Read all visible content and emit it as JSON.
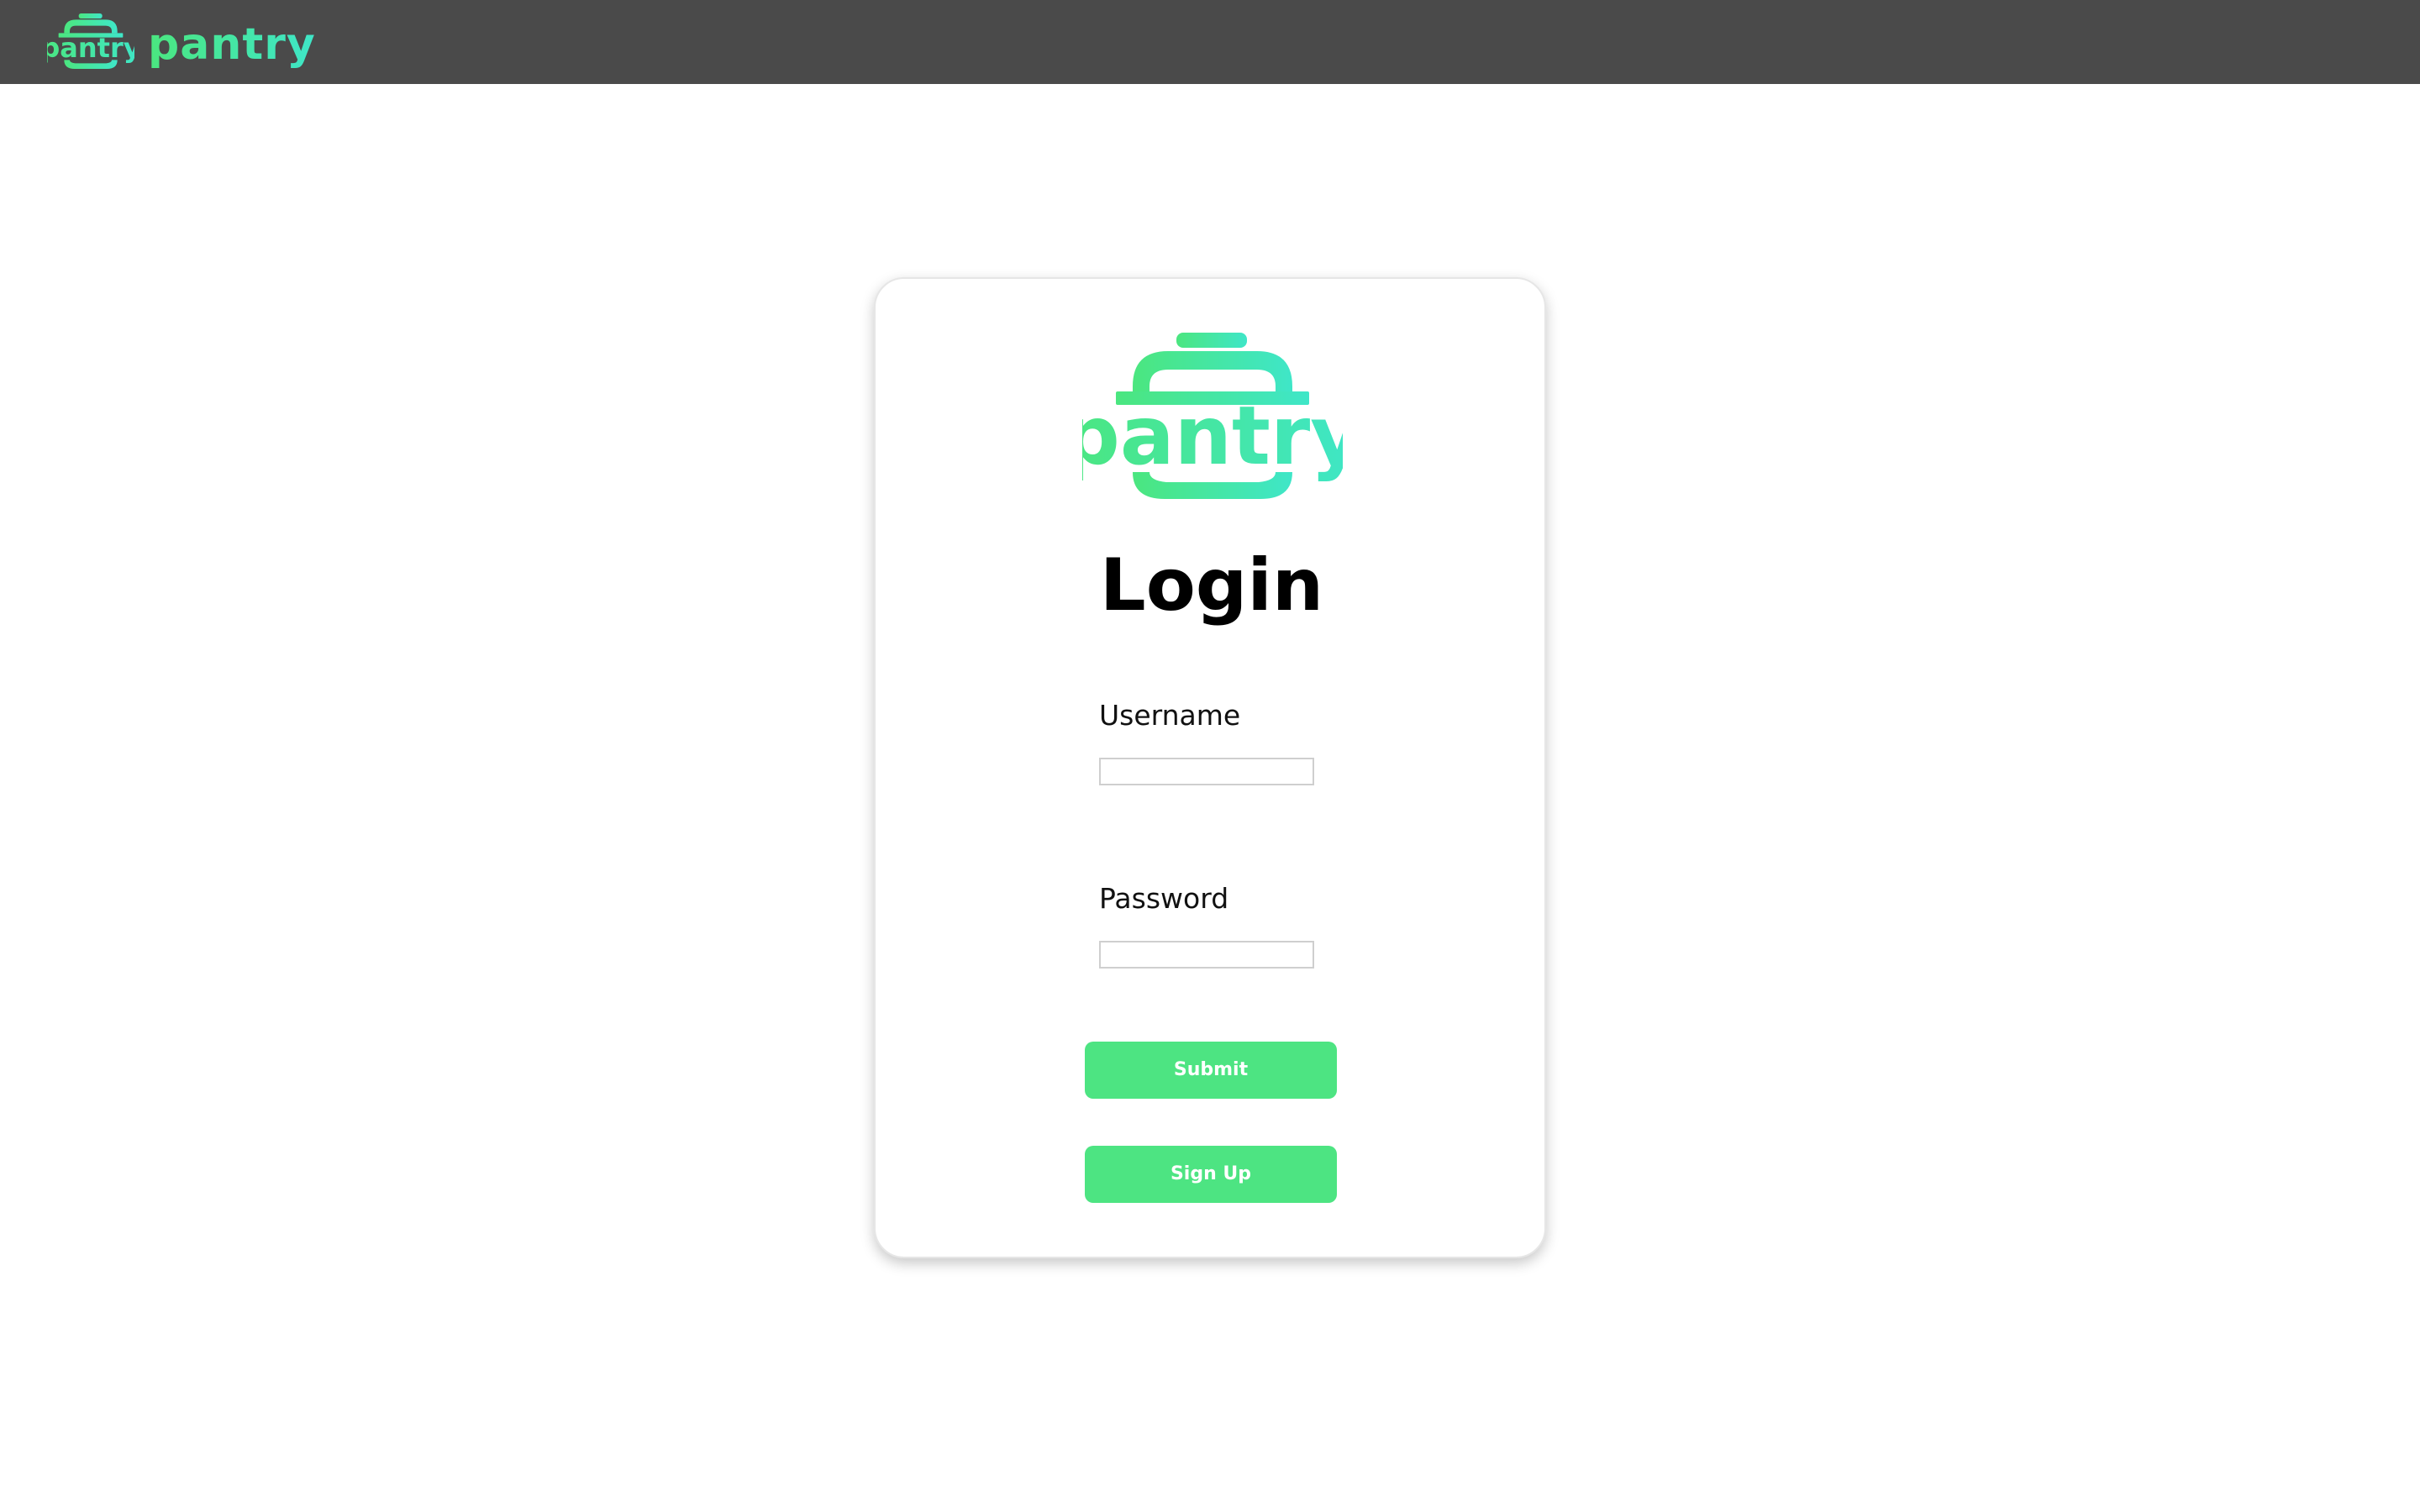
{
  "topbar": {
    "brand": "pantry",
    "logo_icon": "pantry-pot-logo-icon",
    "logo_text": "pantry",
    "background": "#4a4a4a"
  },
  "card": {
    "logo_icon": "pantry-pot-logo-icon",
    "logo_text": "pantry",
    "title": "Login",
    "username_label": "Username",
    "username_value": "",
    "password_label": "Password",
    "password_value": "",
    "submit_label": "Submit",
    "signup_label": "Sign Up"
  },
  "colors": {
    "brand_green": "#4be67f",
    "brand_teal": "#3fe6c8",
    "button_green": "#4de482",
    "topbar": "#4a4a4a"
  }
}
